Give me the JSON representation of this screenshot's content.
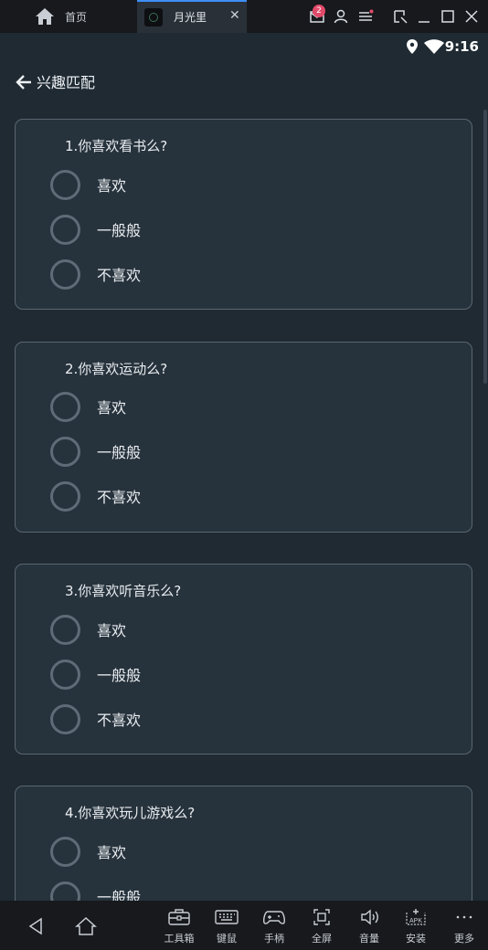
{
  "emulator": {
    "home_tab_label": "首页",
    "app_tab_label": "月光里",
    "mail_badge_count": "2",
    "toolbar": [
      {
        "label": "工具箱",
        "icon": "toolbox-icon"
      },
      {
        "label": "键鼠",
        "icon": "keyboard-icon"
      },
      {
        "label": "手柄",
        "icon": "gamepad-icon"
      },
      {
        "label": "全屏",
        "icon": "fullscreen-icon"
      },
      {
        "label": "音量",
        "icon": "volume-icon"
      },
      {
        "label": "安装",
        "icon": "apk-install-icon"
      },
      {
        "label": "更多",
        "icon": "more-icon"
      }
    ]
  },
  "status_bar": {
    "time": "9:16"
  },
  "header": {
    "title": "兴趣匹配"
  },
  "questions": [
    {
      "title": "1.你喜欢看书么?",
      "options": [
        "喜欢",
        "一般般",
        "不喜欢"
      ]
    },
    {
      "title": "2.你喜欢运动么?",
      "options": [
        "喜欢",
        "一般般",
        "不喜欢"
      ]
    },
    {
      "title": "3.你喜欢听音乐么?",
      "options": [
        "喜欢",
        "一般般",
        "不喜欢"
      ]
    },
    {
      "title": "4.你喜欢玩儿游戏么?",
      "options": [
        "喜欢",
        "一般般"
      ]
    }
  ],
  "colors": {
    "background": "#1f2a33",
    "card": "#26323c",
    "card_border": "#5a6671",
    "radio": "#5f6b76",
    "accent": "#3e8ef7",
    "badge": "#e24a6a"
  }
}
